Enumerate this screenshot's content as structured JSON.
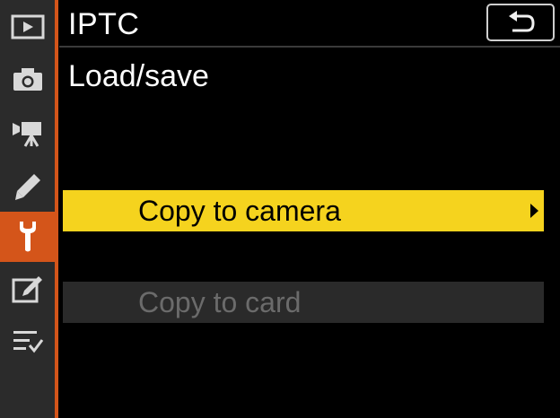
{
  "header": {
    "title": "IPTC",
    "back_button_icon": "return-arrow-icon"
  },
  "subtitle": "Load/save",
  "sidebar": {
    "tabs": [
      {
        "icon": "playback-icon",
        "active": false
      },
      {
        "icon": "camera-icon",
        "active": false
      },
      {
        "icon": "movie-camera-icon",
        "active": false
      },
      {
        "icon": "pencil-icon",
        "active": false
      },
      {
        "icon": "wrench-icon",
        "active": true
      },
      {
        "icon": "retouch-icon",
        "active": false
      },
      {
        "icon": "my-menu-icon",
        "active": false
      }
    ]
  },
  "menu": {
    "items": [
      {
        "label": "Copy to camera",
        "state": "selected",
        "has_submenu": true
      },
      {
        "label": "Copy to card",
        "state": "disabled",
        "has_submenu": false
      }
    ]
  },
  "colors": {
    "accent": "#d4551a",
    "highlight": "#f5d31e",
    "disabled_text": "#6b6b6b",
    "sidebar_bg": "#2b2b2b"
  }
}
